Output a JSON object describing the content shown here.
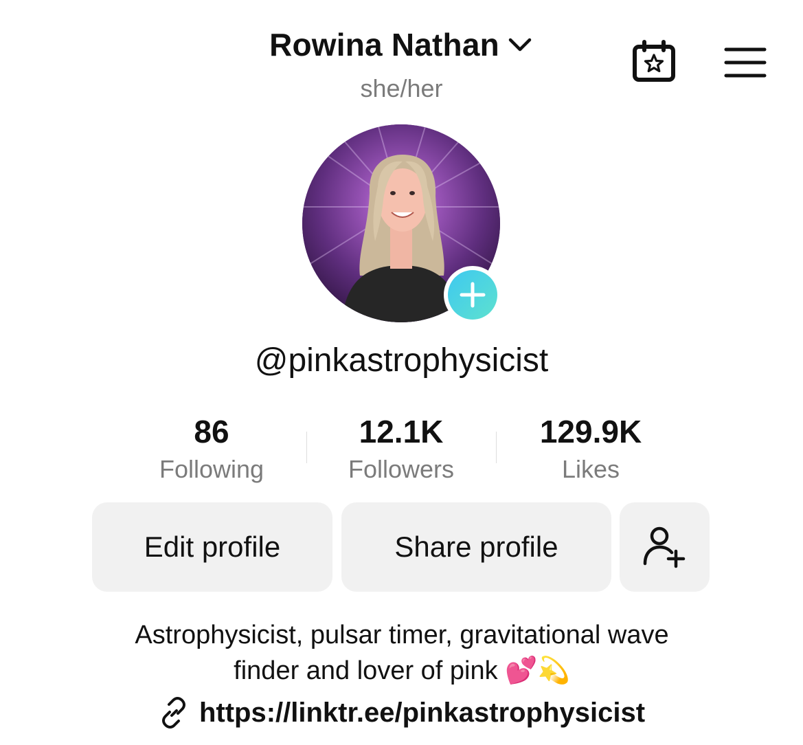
{
  "header": {
    "display_name": "Rowina Nathan",
    "pronouns": "she/her"
  },
  "profile": {
    "username": "@pinkastrophysicist"
  },
  "stats": [
    {
      "value": "86",
      "label": "Following"
    },
    {
      "value": "12.1K",
      "label": "Followers"
    },
    {
      "value": "129.9K",
      "label": "Likes"
    }
  ],
  "actions": {
    "edit_label": "Edit profile",
    "share_label": "Share profile"
  },
  "bio": {
    "line1": "Astrophysicist, pulsar timer, gravitational wave",
    "line2": "finder and lover of pink 💕💫"
  },
  "link": {
    "url": "https://linktr.ee/pinkastrophysicist"
  },
  "icons": {
    "chevron": "chevron-down-icon",
    "calendar": "calendar-star-icon",
    "menu": "hamburger-menu-icon",
    "add": "plus-icon",
    "add_friend": "add-person-icon",
    "link": "link-icon"
  },
  "colors": {
    "badge_gradient_start": "#3ec9f0",
    "badge_gradient_end": "#5ee1cf",
    "button_bg": "#f1f1f1",
    "muted_text": "#7b7b7b"
  }
}
